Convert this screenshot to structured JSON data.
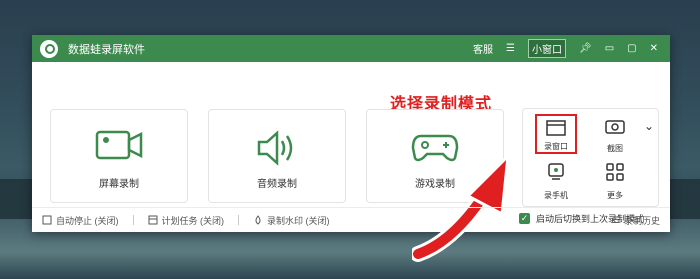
{
  "window": {
    "title": "数据蛙录屏软件",
    "service_label": "客服",
    "mini_window_label": "小窗口"
  },
  "annotation": {
    "tip": "选择录制模式"
  },
  "modes": [
    {
      "label": "屏幕录制",
      "icon": "video-camera-icon"
    },
    {
      "label": "音频录制",
      "icon": "speaker-icon"
    },
    {
      "label": "游戏录制",
      "icon": "gamepad-icon"
    }
  ],
  "panel": {
    "items": [
      {
        "label": "录窗口",
        "icon": "window-icon"
      },
      {
        "label": "截图",
        "icon": "camera-icon"
      },
      {
        "label": "录手机",
        "icon": "phone-icon"
      },
      {
        "label": "更多",
        "icon": "grid-icon"
      }
    ]
  },
  "option": {
    "label": "启动后切换到上次录制模式",
    "checked": true
  },
  "footer": {
    "auto_stop": "自动停止 (关闭)",
    "schedule": "计划任务 (关闭)",
    "watermark": "录制水印 (关闭)",
    "history": "录制历史"
  },
  "colors": {
    "accent": "#3c8a4e",
    "annotation": "#e02020"
  }
}
